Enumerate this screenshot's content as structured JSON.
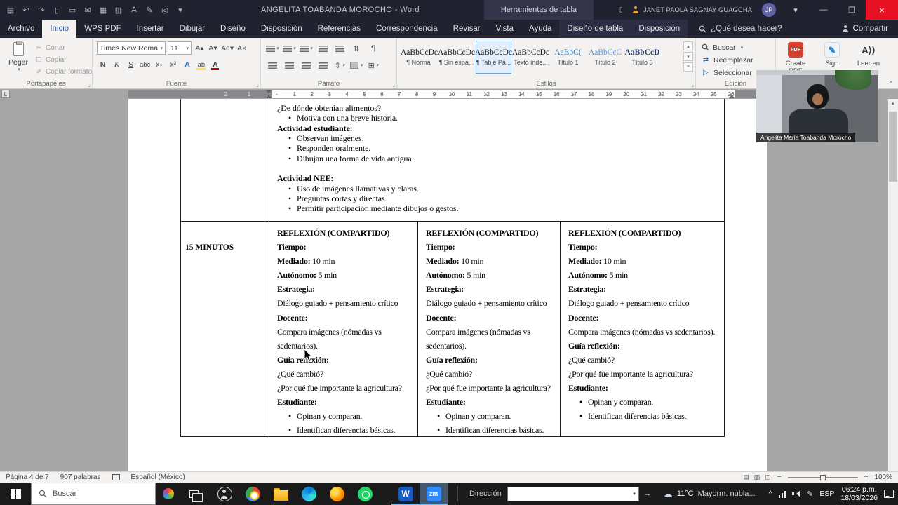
{
  "glyphs": {
    "caret": "▾",
    "launcher": "⌟",
    "bullet": "•",
    "up": "▴",
    "down": "▾",
    "more": "≡",
    "collapse": "^",
    "chevron_up": "^",
    "pen": "✎",
    "go": "→"
  },
  "title_bar": {
    "quick_access": [
      {
        "name": "save-icon",
        "glyph": "▤"
      },
      {
        "name": "undo-icon",
        "glyph": "↶"
      },
      {
        "name": "redo-icon",
        "glyph": "↷"
      },
      {
        "name": "new-document-icon",
        "glyph": "▯"
      },
      {
        "name": "open-folder-icon",
        "glyph": "▭"
      },
      {
        "name": "email-icon",
        "glyph": "✉"
      },
      {
        "name": "table-icon",
        "glyph": "▦"
      },
      {
        "name": "quick-print-icon",
        "glyph": "▥"
      },
      {
        "name": "font-tool-icon",
        "glyph": "A"
      },
      {
        "name": "draw-icon",
        "glyph": "✎"
      },
      {
        "name": "touch-mode-icon",
        "glyph": "◎"
      },
      {
        "name": "customize-quick-access-icon",
        "glyph": "▾"
      }
    ],
    "title": "ANGELITA TOABANDA MOROCHO  -  Word",
    "contextual_header": "Herramientas de tabla",
    "moon_glyph": "☾",
    "user_name": "JANET PAOLA SAGNAY GUAGCHA",
    "avatar_initials": "JP",
    "minimize_glyph": "—",
    "restore_glyph": "❐",
    "close_glyph": "×"
  },
  "ribbon": {
    "tabs": [
      {
        "label": "Archivo"
      },
      {
        "label": "Inicio",
        "active": true
      },
      {
        "label": "WPS PDF"
      },
      {
        "label": "Insertar"
      },
      {
        "label": "Dibujar"
      },
      {
        "label": "Diseño"
      },
      {
        "label": "Disposición"
      },
      {
        "label": "Referencias"
      },
      {
        "label": "Correspondencia"
      },
      {
        "label": "Revisar"
      },
      {
        "label": "Vista"
      },
      {
        "label": "Ayuda"
      },
      {
        "label": "Diseño de tabla",
        "contextual": true
      },
      {
        "label": "Disposición",
        "contextual": true
      }
    ],
    "tell_me": "¿Qué desea hacer?",
    "share": "Compartir",
    "clipboard": {
      "paste_label": "Pegar",
      "items": [
        {
          "name": "cut-button",
          "glyph": "✂",
          "label": "Cortar"
        },
        {
          "name": "copy-button",
          "glyph": "❐",
          "label": "Copiar"
        },
        {
          "name": "format-painter-button",
          "glyph": "✐",
          "label": "Copiar formato"
        }
      ],
      "group_label": "Portapapeles"
    },
    "font": {
      "family": "Times New Roma",
      "size": "11",
      "top_buttons": [
        {
          "name": "grow-font-button",
          "glyph": "A▴"
        },
        {
          "name": "shrink-font-button",
          "glyph": "A▾"
        },
        {
          "name": "change-case-button",
          "glyph": "Aa▾"
        },
        {
          "name": "clear-formatting-button",
          "glyph": "A×"
        }
      ],
      "bottom_buttons": [
        {
          "name": "bold-button",
          "glyph": "N",
          "cls": "b"
        },
        {
          "name": "italic-button",
          "glyph": "K",
          "cls": "i"
        },
        {
          "name": "underline-button",
          "glyph": "S",
          "cls": "u"
        },
        {
          "name": "strikethrough-button",
          "glyph": "abc",
          "cls": "st"
        },
        {
          "name": "subscript-button",
          "glyph": "x₂"
        },
        {
          "name": "superscript-button",
          "glyph": "x²"
        },
        {
          "name": "text-effects-button",
          "glyph": "A",
          "cls": "fx"
        },
        {
          "name": "highlight-button",
          "glyph": "ab",
          "cls": "hl"
        },
        {
          "name": "font-color-button",
          "glyph": "A",
          "cls": "fc"
        }
      ],
      "group_label": "Fuente"
    },
    "paragraph": {
      "top_buttons": [
        {
          "name": "bullets-button",
          "kind": "bars",
          "caret": true
        },
        {
          "name": "numbering-button",
          "kind": "bars",
          "caret": true
        },
        {
          "name": "multilevel-list-button",
          "kind": "bars",
          "caret": true
        },
        {
          "name": "decrease-indent-button",
          "kind": "bars"
        },
        {
          "name": "increase-indent-button",
          "kind": "bars"
        },
        {
          "name": "sort-button",
          "glyph": "⇅"
        },
        {
          "name": "show-marks-button",
          "glyph": "¶"
        }
      ],
      "bottom_buttons": [
        {
          "name": "align-left-button",
          "kind": "bars"
        },
        {
          "name": "align-center-button",
          "kind": "bars"
        },
        {
          "name": "align-right-button",
          "kind": "bars"
        },
        {
          "name": "justify-button",
          "kind": "bars"
        },
        {
          "name": "line-spacing-button",
          "glyph": "⇕",
          "caret": true
        },
        {
          "name": "shading-button",
          "kind": "shade",
          "caret": true
        },
        {
          "name": "borders-button",
          "glyph": "⊞",
          "caret": true
        }
      ],
      "group_label": "Párrafo"
    },
    "styles": {
      "items": [
        {
          "preview": "AaBbCcDc",
          "name": "¶ Normal"
        },
        {
          "preview": "AaBbCcDc",
          "name": "¶ Sin espa..."
        },
        {
          "preview": "AaBbCcDc",
          "name": "¶ Table Pa..."
        },
        {
          "preview": "AaBbCcDc",
          "name": "Texto inde..."
        },
        {
          "preview": "AaBbC(",
          "name": "Título 1",
          "cls": "t1"
        },
        {
          "preview": "AaBbCcC",
          "name": "Título 2",
          "cls": "t2"
        },
        {
          "preview": "AaBbCcD",
          "name": "Título 3",
          "cls": "t3"
        }
      ],
      "selected": "¶ Table Pa...",
      "group_label": "Estilos"
    },
    "editing": {
      "items": [
        {
          "name": "find-button",
          "icon": "search",
          "label": "Buscar",
          "caret": true
        },
        {
          "name": "replace-button",
          "icon": "replace",
          "icon_glyph": "⇄",
          "label": "Reemplazar"
        },
        {
          "name": "select-button",
          "icon": "select",
          "icon_glyph": "▷",
          "label": "Seleccionar",
          "caret": true
        }
      ],
      "group_label": "Edición"
    },
    "extras": [
      {
        "name": "create-pdf-button",
        "icon": "pdf",
        "icon_text": "PDF",
        "label": "Create PDF"
      },
      {
        "name": "sign-button",
        "icon": "sign",
        "icon_text": "✎",
        "label": "Sign"
      },
      {
        "name": "read-aloud-button",
        "icon": "read-aloud",
        "icon_text": "A⟩⟩",
        "label": "Leer en"
      }
    ]
  },
  "ruler": {
    "tab_selector": "L",
    "left_numbers": [
      "2",
      "1"
    ],
    "numbers": [
      "1",
      "2",
      "3",
      "4",
      "5",
      "6",
      "7",
      "8",
      "9",
      "10",
      "11",
      "12",
      "13",
      "14",
      "15",
      "16",
      "17",
      "18",
      "19",
      "20",
      "21",
      "22",
      "23",
      "24",
      "25",
      "26"
    ]
  },
  "document": {
    "top_cell": [
      {
        "runs": [
          {
            "t": "¿De dónde obtenían alimentos?"
          }
        ]
      },
      {
        "bullet": true,
        "runs": [
          {
            "t": "Motiva con una breve historia."
          }
        ]
      },
      {
        "runs": [
          {
            "t": "Actividad estudiante:",
            "b": true
          }
        ]
      },
      {
        "bullet": true,
        "runs": [
          {
            "t": "Observan imágenes."
          }
        ]
      },
      {
        "bullet": true,
        "runs": [
          {
            "t": "Responden oralmente."
          }
        ]
      },
      {
        "bullet": true,
        "runs": [
          {
            "t": "Dibujan una forma de vida antigua."
          }
        ]
      },
      {
        "blank": true
      },
      {
        "runs": [
          {
            "t": "Actividad NEE:",
            "b": true
          }
        ]
      },
      {
        "bullet": true,
        "runs": [
          {
            "t": "Uso de imágenes llamativas y claras."
          }
        ]
      },
      {
        "bullet": true,
        "runs": [
          {
            "t": "Preguntas cortas y directas."
          }
        ]
      },
      {
        "bullet": true,
        "runs": [
          {
            "t": "Permitir participación mediante dibujos o gestos."
          }
        ]
      }
    ],
    "row_label": "15 MINUTOS",
    "reflection_columns": [
      {
        "lines": [
          {
            "runs": [
              {
                "t": "REFLEXIÓN (COMPARTIDO)",
                "b": true
              }
            ]
          },
          {
            "runs": [
              {
                "t": "Tiempo:",
                "b": true
              }
            ]
          },
          {
            "runs": [
              {
                "t": "Mediado:",
                "b": true
              },
              {
                "t": " 10 min"
              }
            ]
          },
          {
            "runs": [
              {
                "t": "Autónomo:",
                "b": true
              },
              {
                "t": " 5 min"
              }
            ]
          },
          {
            "runs": [
              {
                "t": "Estrategia:",
                "b": true
              }
            ]
          },
          {
            "runs": [
              {
                "t": "Diálogo guiado + pensamiento crítico"
              }
            ]
          },
          {
            "runs": [
              {
                "t": "Docente:",
                "b": true
              }
            ]
          },
          {
            "runs": [
              {
                "t": "Compara imágenes (nómadas vs"
              }
            ]
          },
          {
            "runs": [
              {
                "t": "sedentarios)."
              }
            ]
          },
          {
            "runs": [
              {
                "t": "Guía reflexión:",
                "b": true
              }
            ]
          },
          {
            "runs": [
              {
                "t": "¿Qué cambió?"
              }
            ]
          },
          {
            "runs": [
              {
                "t": "¿Por qué fue importante la agricultura?"
              }
            ]
          },
          {
            "runs": [
              {
                "t": "Estudiante:",
                "b": true
              }
            ]
          },
          {
            "bullet": true,
            "runs": [
              {
                "t": "Opinan y comparan."
              }
            ]
          },
          {
            "bullet": true,
            "runs": [
              {
                "t": "Identifican diferencias básicas."
              }
            ]
          }
        ]
      },
      {
        "lines": [
          {
            "runs": [
              {
                "t": "REFLEXIÓN (COMPARTIDO)",
                "b": true
              }
            ]
          },
          {
            "runs": [
              {
                "t": "Tiempo:",
                "b": true
              }
            ]
          },
          {
            "runs": [
              {
                "t": "Mediado:",
                "b": true
              },
              {
                "t": " 10 min"
              }
            ]
          },
          {
            "runs": [
              {
                "t": "Autónomo:",
                "b": true
              },
              {
                "t": " 5 min"
              }
            ]
          },
          {
            "runs": [
              {
                "t": "Estrategia:",
                "b": true
              }
            ]
          },
          {
            "runs": [
              {
                "t": "Diálogo guiado + pensamiento crítico"
              }
            ]
          },
          {
            "runs": [
              {
                "t": "Docente:",
                "b": true
              }
            ]
          },
          {
            "runs": [
              {
                "t": "Compara imágenes (nómadas vs"
              }
            ]
          },
          {
            "runs": [
              {
                "t": "sedentarios)."
              }
            ]
          },
          {
            "runs": [
              {
                "t": "Guía reflexión:",
                "b": true
              }
            ]
          },
          {
            "runs": [
              {
                "t": "¿Qué cambió?"
              }
            ]
          },
          {
            "runs": [
              {
                "t": "¿Por qué fue importante la agricultura?"
              }
            ]
          },
          {
            "runs": [
              {
                "t": "Estudiante:",
                "b": true
              }
            ]
          },
          {
            "bullet": true,
            "runs": [
              {
                "t": "Opinan y comparan."
              }
            ]
          },
          {
            "bullet": true,
            "runs": [
              {
                "t": "Identifican diferencias básicas."
              }
            ]
          }
        ]
      },
      {
        "lines": [
          {
            "runs": [
              {
                "t": "REFLEXIÓN (COMPARTIDO)",
                "b": true
              }
            ]
          },
          {
            "runs": [
              {
                "t": "Tiempo:",
                "b": true
              }
            ]
          },
          {
            "runs": [
              {
                "t": "Mediado:",
                "b": true
              },
              {
                "t": " 10 min"
              }
            ]
          },
          {
            "runs": [
              {
                "t": "Autónomo:",
                "b": true
              },
              {
                "t": " 5 min"
              }
            ]
          },
          {
            "runs": [
              {
                "t": "Estrategia:",
                "b": true
              }
            ]
          },
          {
            "runs": [
              {
                "t": "Diálogo guiado + pensamiento crítico"
              }
            ]
          },
          {
            "runs": [
              {
                "t": "Docente:",
                "b": true
              }
            ]
          },
          {
            "runs": [
              {
                "t": "Compara imágenes (nómadas vs sedentarios)."
              }
            ]
          },
          {
            "runs": [
              {
                "t": "Guía reflexión:",
                "b": true
              }
            ]
          },
          {
            "runs": [
              {
                "t": "¿Qué cambió?"
              }
            ]
          },
          {
            "runs": [
              {
                "t": "¿Por qué fue importante la agricultura?"
              }
            ]
          },
          {
            "runs": [
              {
                "t": "Estudiante:",
                "b": true
              }
            ]
          },
          {
            "bullet": true,
            "runs": [
              {
                "t": "Opinan y comparan."
              }
            ]
          },
          {
            "bullet": true,
            "runs": [
              {
                "t": "Identifican diferencias básicas."
              }
            ]
          }
        ]
      }
    ]
  },
  "status_bar": {
    "page": "Página 4 de 7",
    "words": "907 palabras",
    "language": "Español (México)",
    "zoom": "100%",
    "minus": "−",
    "plus": "+",
    "view_icons": [
      {
        "name": "read-mode-icon",
        "glyph": "▤"
      },
      {
        "name": "print-layout-icon",
        "glyph": "▥"
      },
      {
        "name": "web-layout-icon",
        "glyph": "▢"
      }
    ]
  },
  "taskbar": {
    "search_placeholder": "Buscar",
    "apps": [
      {
        "name": "taskbar-people-icon",
        "kind": "people"
      },
      {
        "name": "taskbar-chrome-icon",
        "kind": "chrome"
      },
      {
        "name": "taskbar-folder-icon",
        "kind": "folder"
      },
      {
        "name": "taskbar-edge-icon",
        "kind": "edge"
      },
      {
        "name": "taskbar-firefox-icon",
        "kind": "firefox"
      },
      {
        "name": "taskbar-whatsapp-icon",
        "kind": "whatsapp"
      },
      {
        "name": "taskbar-word-icon",
        "kind": "word",
        "label": "W",
        "open": true,
        "gap": true
      },
      {
        "name": "taskbar-zoom-icon",
        "kind": "zoom",
        "label": "zm",
        "open": true,
        "active": true
      }
    ],
    "address_label": "Dirección",
    "weather_glyph": "☁",
    "weather_temp": "11°C",
    "weather_desc": "Mayorm. nubla...",
    "lang": "ESP",
    "time": "06:24 p.m.",
    "date": "18/03/2026"
  },
  "webcam": {
    "name": "Angelita Maria Toabanda Morocho"
  }
}
